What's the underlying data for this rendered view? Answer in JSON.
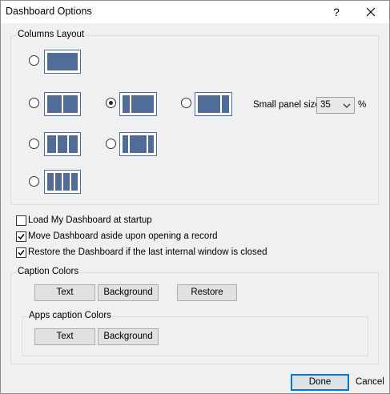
{
  "window": {
    "title": "Dashboard Options",
    "help_glyph": "?",
    "close_icon": "close-icon"
  },
  "columns_layout": {
    "label": "Columns Layout",
    "options": [
      {
        "id": "1col",
        "panels": [
          1
        ],
        "selected": false
      },
      {
        "id": "2col-equal",
        "panels": [
          1,
          1
        ],
        "selected": false
      },
      {
        "id": "2col-small-left",
        "panels": [
          0.3,
          1
        ],
        "selected": true
      },
      {
        "id": "2col-small-right",
        "panels": [
          1,
          0.3
        ],
        "selected": false
      },
      {
        "id": "3col-equal",
        "panels": [
          1,
          1,
          1
        ],
        "selected": false
      },
      {
        "id": "3col-small-sides",
        "panels": [
          0.3,
          1,
          0.3
        ],
        "selected": false
      },
      {
        "id": "4col-equal",
        "panels": [
          1,
          1,
          1,
          1
        ],
        "selected": false
      }
    ],
    "small_panel_label": "Small panel size",
    "small_panel_value": "35",
    "small_panel_unit": "%"
  },
  "checkboxes": [
    {
      "label": "Load My Dashboard at startup",
      "checked": false
    },
    {
      "label": "Move Dashboard aside upon opening a record",
      "checked": true
    },
    {
      "label": "Restore the Dashboard if the last internal window is closed",
      "checked": true
    }
  ],
  "caption_colors": {
    "label": "Caption Colors",
    "text_button": "Text",
    "background_button": "Background",
    "restore_button": "Restore"
  },
  "apps_caption_colors": {
    "label": "Apps caption Colors",
    "text_button": "Text",
    "background_button": "Background"
  },
  "footer": {
    "done_button": "Done",
    "cancel_link": "Cancel"
  },
  "colors": {
    "panel_fill": "#4f6d96",
    "panel_border": "#4a6a9c",
    "default_button_border": "#0078d7"
  }
}
